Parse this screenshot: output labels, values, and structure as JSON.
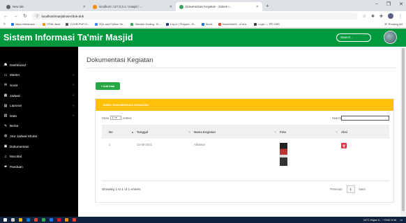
{
  "browser": {
    "tabs": [
      {
        "title": "New tab",
        "active": false,
        "color": "#5f6368"
      },
      {
        "title": "localhost / 127.0.0.1 / masjid / ...",
        "active": false,
        "color": "#f08c00"
      },
      {
        "title": "Dokumentasi Kegiatan - Sistem I...",
        "active": true,
        "color": "#3ea35a"
      }
    ],
    "new_tab": "+",
    "controls": {
      "minimize": "–",
      "maximize": "❐",
      "close": "✕"
    },
    "url": "localhost/masjid/user/dok-dok",
    "bookmarks": [
      "https://webkuwe...",
      "HTML Best",
      "YOUR-PHP-S...",
      "SQL and Python Se...",
      "Sekolah Koding - B...",
      "Log in | Prepare - B...",
      "Mode",
      "SweetAlert2 - a bea...",
      "Login — PR CMS"
    ],
    "bookmark_colors": [
      "#1a73e8",
      "#f29900",
      "#555",
      "#4285f4",
      "#34a853",
      "#1e3a8a",
      "#1a73e8",
      "#ea4335",
      "#444"
    ],
    "reading_list": "Reading list"
  },
  "app": {
    "title": "Sistem Informasi Ta'mir Masjid",
    "search_placeholder": "Search...",
    "accent": "#009a3e"
  },
  "sidebar": {
    "items": [
      {
        "label": "Dashboard",
        "icon": "☗",
        "chevron": false
      },
      {
        "label": "Master",
        "icon": "▭",
        "chevron": true
      },
      {
        "label": "Surat",
        "icon": "✉",
        "chevron": true
      },
      {
        "label": "Jadwal",
        "icon": "▦",
        "chevron": true
      },
      {
        "label": "Laporan",
        "icon": "▤",
        "chevron": true
      },
      {
        "label": "Data",
        "icon": "▥",
        "chevron": true
      },
      {
        "label": "Berita",
        "icon": "✎",
        "chevron": false
      },
      {
        "label": "Atur Jadwal Sholat",
        "icon": "◍",
        "chevron": false
      },
      {
        "label": "Dokumentasi",
        "icon": "▣",
        "chevron": false
      },
      {
        "label": "Murottal",
        "icon": "♫",
        "chevron": false
      },
      {
        "label": "Panduan",
        "icon": "▰",
        "chevron": false
      }
    ]
  },
  "main": {
    "page_title": "Dokumentasi Kegiatan",
    "add_button": "+ Add Data",
    "card_title": "TABEL DOKUMENTASI KEGIATAN",
    "show_label": "Show",
    "show_value": "10",
    "entries_label": "entries",
    "search_label": "Search:",
    "columns": [
      "No",
      "Tanggal",
      "Nama Kegiatan",
      "Foto",
      "Aksi"
    ],
    "rows": [
      {
        "no": "1",
        "tanggal": "13-08-2021",
        "nama": "Albarnia"
      }
    ],
    "info": "Showing 1 to 1 of 1 entries",
    "pager": {
      "previous": "Previous",
      "current": "1",
      "next": "Next"
    }
  },
  "taskbar": {
    "icon_colors": [
      "#ffffff",
      "#cccccc",
      "#f4b400",
      "#0078d7",
      "#ea4335",
      "#34a853",
      "#1a73e8",
      "#e81123",
      "#ff8c00",
      "#ea4335"
    ],
    "tray_text": "24°C Hujan ri...  ^  ENG  9:10"
  }
}
